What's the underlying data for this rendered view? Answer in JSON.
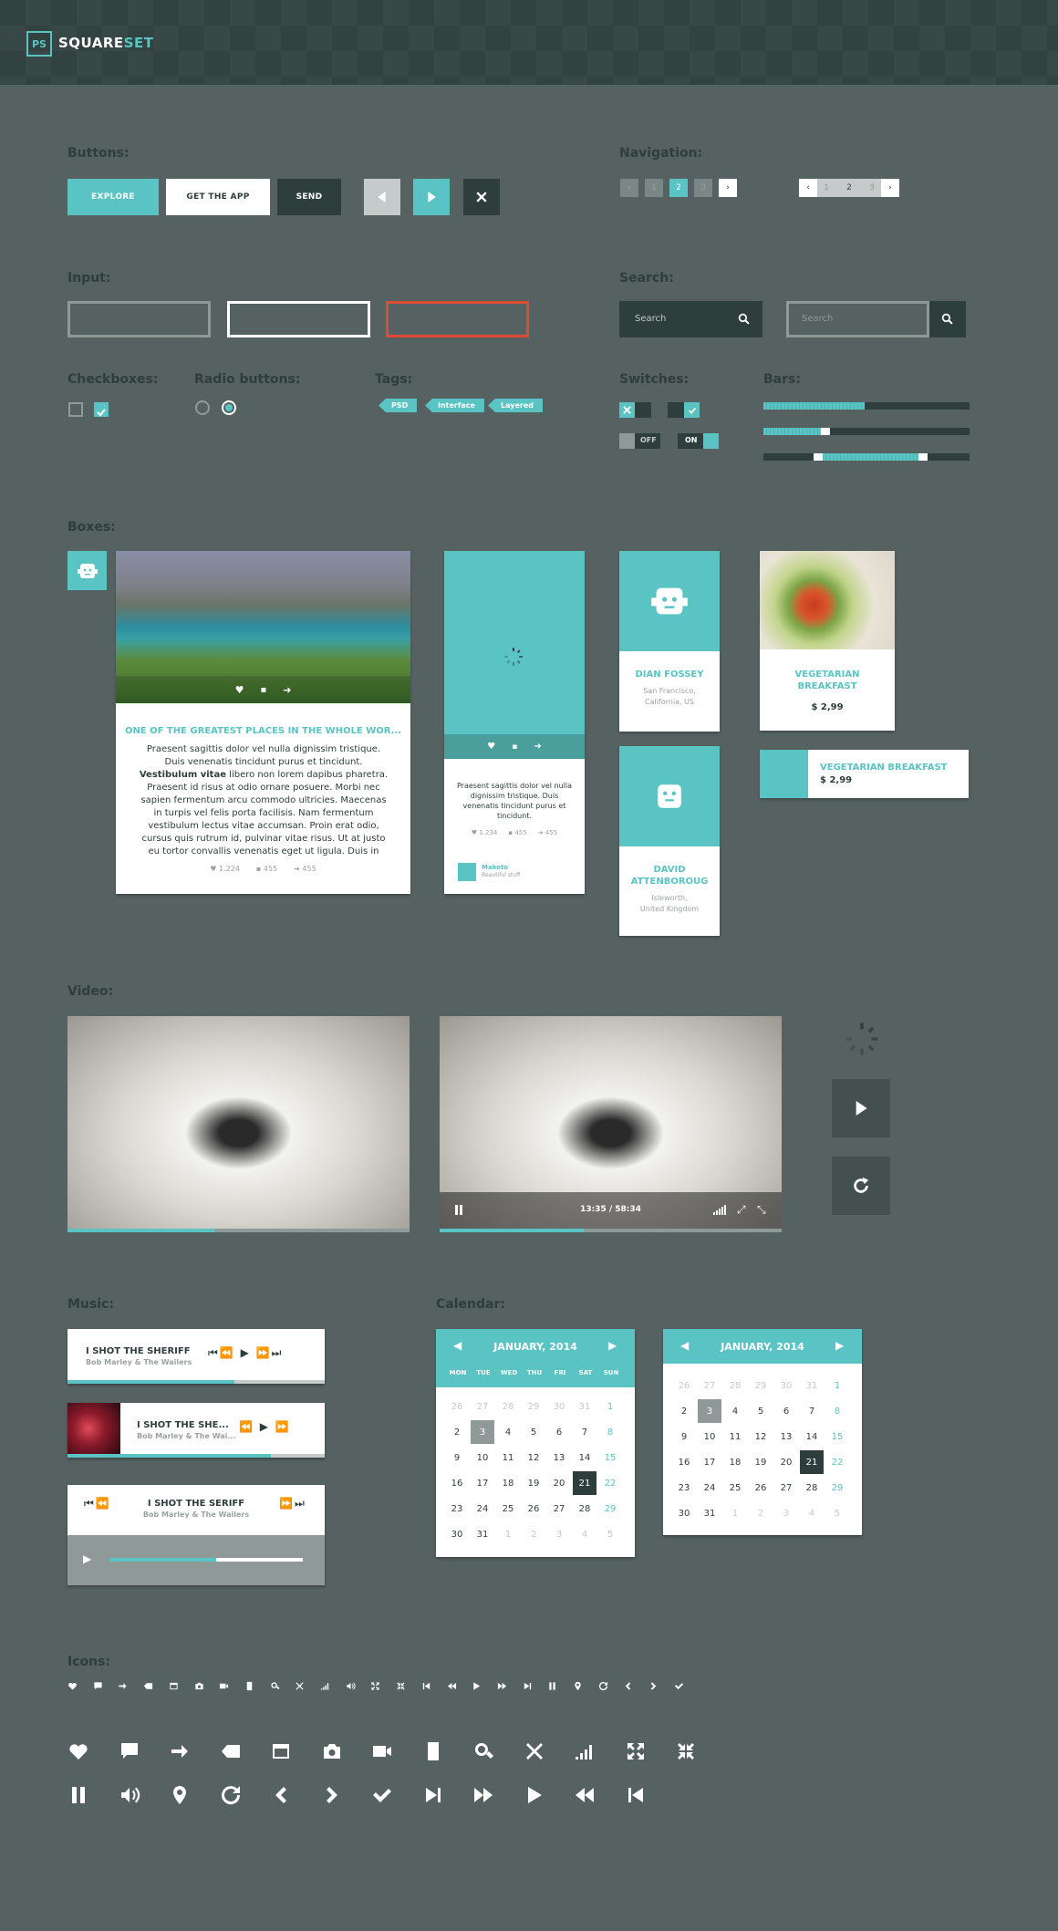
{
  "brand": {
    "logo_box": "PS",
    "name_a": "SQUARE",
    "name_b": "SET",
    "accent": "#5ac4c4",
    "dark": "#2e3e3c",
    "background": "#566261"
  },
  "sections": {
    "buttons": "Buttons:",
    "navigation": "Navigation:",
    "input": "Input:",
    "search": "Search:",
    "checkboxes": "Checkboxes:",
    "radio": "Radio buttons:",
    "tags": "Tags:",
    "switches": "Switches:",
    "bars": "Bars:",
    "boxes": "Boxes:",
    "video": "Video:",
    "music": "Music:",
    "calendar": "Calendar:",
    "icons": "Icons:"
  },
  "buttons": {
    "explore": "EXPLORE",
    "get_app": "GET THE APP",
    "send": "SEND"
  },
  "navigation": {
    "pager1": [
      "1",
      "2",
      "3"
    ],
    "pager2": [
      "1",
      "2",
      "3"
    ],
    "active": "2"
  },
  "search": {
    "placeholder1": "Search",
    "placeholder2": "Search"
  },
  "tags": [
    "PSD",
    "Interface",
    "Layered"
  ],
  "switches": {
    "off": "OFF",
    "on": "ON"
  },
  "bars": [
    0.49,
    0.28,
    0.75
  ],
  "boxes": {
    "article": {
      "title": "ONE OF THE GREATEST PLACES IN THE WHOLE WOR...",
      "body_a": "Praesent sagittis dolor vel nulla dignissim tristique. Duis venenatis tincidunt purus et tincidunt. ",
      "body_bold": "Vestibulum vitae",
      "body_b": " libero non lorem dapibus pharetra. Praesent id risus at odio ornare posuere. Morbi nec sapien fermentum arcu commodo ultricies. Maecenas in turpis vel felis porta facilisis. Nam fermentum vestibulum lectus vitae accumsan. Proin erat odio, cursus quis rutrum id, pulvinar vitae risus. Ut at justo eu tortor convallis venenatis eget ut ligula. Duis in",
      "likes": "1.224",
      "comments": "455",
      "shares": "455"
    },
    "tall": {
      "body": "Praesent sagittis dolor vel nulla dignissim tristique. Duis venenatis tincidunt purus et tincidunt.",
      "likes": "1.234",
      "comments": "455",
      "shares": "455",
      "author": "Makoto",
      "author_sub": "Beautiful stuff"
    },
    "profile1": {
      "name": "DIAN FOSSEY",
      "loc1": "San Francisco,",
      "loc2": "California, US"
    },
    "profile2": {
      "name1": "DAVID",
      "name2": "ATTENBOROUG",
      "loc1": "Isleworth,",
      "loc2": "United Kingdom"
    },
    "food": {
      "title1": "VEGETARIAN",
      "title2": "BREAKFAST",
      "price": "$ 2,99"
    },
    "food_wide": {
      "title": "VEGETARIAN BREAKFAST",
      "price": "$ 2,99"
    }
  },
  "video": {
    "time": "13:35 / 58:34",
    "progress1": 0.43,
    "progress2": 0.42
  },
  "music": {
    "p1": {
      "title": "I SHOT THE SHERIFF",
      "artist": "Bob Marley & The Wailers",
      "progress": 0.65
    },
    "p2": {
      "title": "I SHOT THE SHE...",
      "artist": "Bob Marley & The Wai...",
      "progress": 0.79
    },
    "p3": {
      "title": "I SHOT THE SERIFF",
      "artist": "Bob Marley & The Wailers",
      "progress": 0.55
    }
  },
  "calendar": {
    "month": "JANUARY, 2014",
    "weekdays": [
      "MON",
      "TUE",
      "WED",
      "THU",
      "FRI",
      "SAT",
      "SUN"
    ],
    "days": [
      "26",
      "27",
      "28",
      "29",
      "30",
      "31",
      "1",
      "2",
      "3",
      "4",
      "5",
      "6",
      "7",
      "8",
      "9",
      "10",
      "11",
      "12",
      "13",
      "14",
      "15",
      "16",
      "17",
      "18",
      "19",
      "20",
      "21",
      "22",
      "23",
      "24",
      "25",
      "26",
      "27",
      "28",
      "29",
      "30",
      "31",
      "1",
      "2",
      "3",
      "4",
      "5"
    ]
  }
}
